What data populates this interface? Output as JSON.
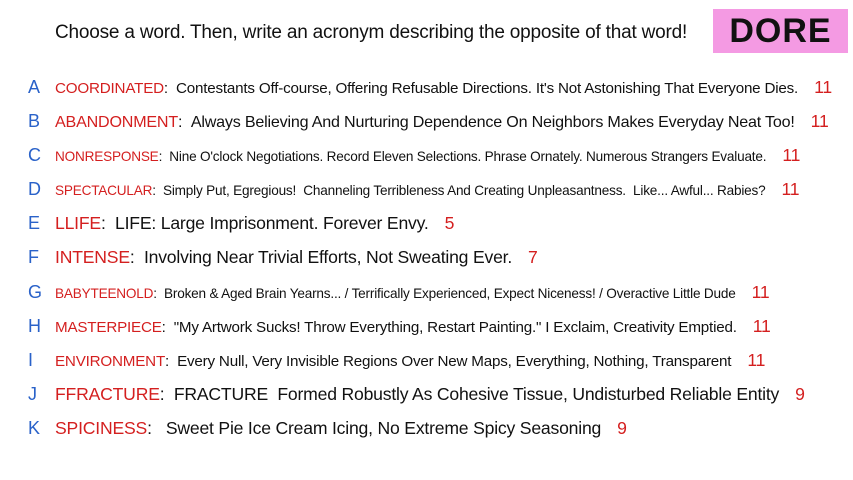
{
  "prompt": "Choose a word. Then, write an acronym describing the opposite of that word!",
  "badge": "DORE",
  "colors": {
    "letter": "#2a62c9",
    "word": "#d41f1f",
    "number": "#d41f1f",
    "badge_bg": "#f49ae3"
  },
  "entries": [
    {
      "letter": "A",
      "word": "COORDINATED",
      "acronym": "Contestants Off-course, Offering Refusable Directions. It's Not Astonishing That Everyone Dies.",
      "count": "11"
    },
    {
      "letter": "B",
      "word": "ABANDONMENT",
      "acronym": "Always Believing And Nurturing Dependence On Neighbors Makes Everyday Neat Too!",
      "count": "11"
    },
    {
      "letter": "C",
      "word": "NONRESPONSE",
      "acronym": "Nine O'clock Negotiations. Record Eleven Selections. Phrase Ornately. Numerous Strangers Evaluate.",
      "count": "11"
    },
    {
      "letter": "D",
      "word": "SPECTACULAR",
      "acronym": "Simply Put, Egregious!  Channeling Terribleness And Creating Unpleasantness.  Like... Awful... Rabies?",
      "count": "11"
    },
    {
      "letter": "E",
      "word": "LLIFE",
      "acronym": "LIFE: Large Imprisonment. Forever Envy.",
      "count": "5"
    },
    {
      "letter": "F",
      "word": "INTENSE",
      "acronym": "Involving Near Trivial Efforts, Not Sweating Ever.",
      "count": "7"
    },
    {
      "letter": "G",
      "word": "BABYTEENOLD",
      "acronym": "Broken & Aged Brain Yearns... / Terrifically Experienced, Expect Niceness! / Overactive Little Dude",
      "count": "11"
    },
    {
      "letter": "H",
      "word": "MASTERPIECE",
      "acronym": "\"My Artwork Sucks! Throw Everything, Restart Painting.\" I Exclaim, Creativity Emptied.",
      "count": "11"
    },
    {
      "letter": "I",
      "word": "ENVIRONMENT",
      "acronym": "Every Null, Very Invisible Regions Over New Maps, Everything, Nothing, Transparent",
      "count": "11"
    },
    {
      "letter": "J",
      "word": "FFRACTURE",
      "acronym": "FRACTURE  Formed Robustly As Cohesive Tissue, Undisturbed Reliable Entity",
      "count": "9"
    },
    {
      "letter": "K",
      "word": "SPICINESS",
      "acronym": " Sweet Pie Ice Cream Icing, No Extreme Spicy Seasoning",
      "count": "9"
    }
  ]
}
